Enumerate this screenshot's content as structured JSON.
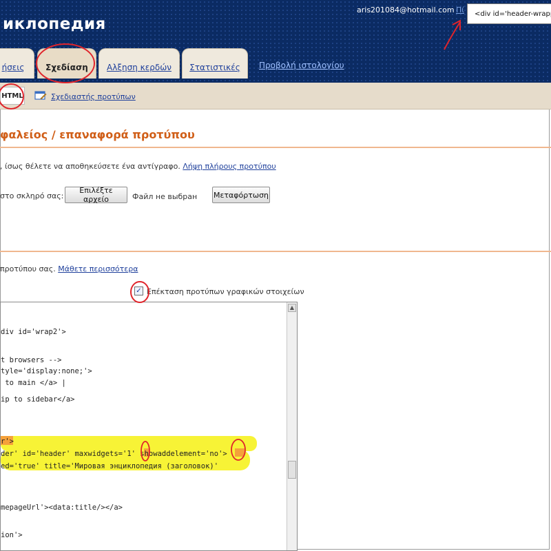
{
  "header": {
    "title": "иклопедия",
    "email": "aris201084@hotmail.com",
    "control_link": "Πί",
    "search_value": "<div id='header-wrappe"
  },
  "tabs": [
    {
      "label": "ήσεις"
    },
    {
      "label": "Σχεδίαση"
    },
    {
      "label": "Αλξηση κερδών"
    },
    {
      "label": "Στατιστικές"
    }
  ],
  "blog_link": "Προβολή ιστολογίου",
  "subbar": {
    "selected": "HTML",
    "editor_link": "Σχεδιαστής προτύπων"
  },
  "page_title": "φαλείος / επαναφορά προτύπου",
  "backup": {
    "text": ", ίσως θέλετε να αποθηκεύσετε ένα αντίγραφο.",
    "link": "Λήψη πλήρους προτύπου"
  },
  "upload": {
    "label": "στο σκληρό σας:",
    "choose_button": "Επιλέξτε αρχείο",
    "no_file": "Файл не выбран",
    "upload_button": "Μεταφόρτωση"
  },
  "template_info": {
    "text": "προτύπου σας.",
    "link": "Μάθετε περισσότερα"
  },
  "expand_checkbox": {
    "checked": true,
    "mark": "✓",
    "label": "Επέκταση προτύπων γραφικών στοιχείων"
  },
  "code_lines": [
    "div id='wrap2'>",
    "t browsers -->",
    "tyle='display:none;'>",
    " to main </a> |",
    "ip to sidebar</a>",
    "r'>",
    "der' id='header' maxwidgets='1' showaddelement='no'>",
    "ed='true' title='Мировая энциклопедия (заголовок)'",
    "mepageUrl'><data:title/></a>",
    "ion'>"
  ],
  "colors": {
    "header_bg": "#0b2b63",
    "tab_bg": "#efe9dd",
    "orange_title": "#d05e17",
    "link": "#1e3f9b",
    "highlight": "#f7f336",
    "annotation": "#e0242b"
  }
}
